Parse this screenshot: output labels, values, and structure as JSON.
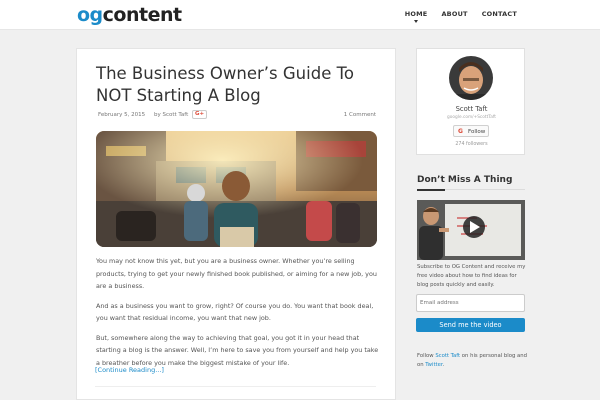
{
  "header": {
    "logo_og": "og",
    "logo_content": "content",
    "nav": [
      {
        "label": "HOME",
        "active": true
      },
      {
        "label": "ABOUT",
        "active": false
      },
      {
        "label": "CONTACT",
        "active": false
      }
    ]
  },
  "post": {
    "title": "The Business Owner’s Guide To NOT Starting A Blog",
    "date": "February 5, 2015",
    "author": "by Scott Taft",
    "gplus_label": "G+",
    "comments": "1 Comment",
    "paragraphs": [
      "You may not know this yet, but you are a business owner. Whether you’re selling products, trying to get your newly finished book published, or aiming for a new job, you are a business.",
      "And as a business you want to grow, right? Of course you do. You want that book deal, you want that residual income, you want that new job.",
      "But, somewhere along the way to achieving that goal, you got it in your head that starting a blog is the answer. Well, I’m here to save you from yourself and help you take a breather before you make the biggest mistake of your life."
    ],
    "read_more": "[Continue Reading...]"
  },
  "profile": {
    "name": "Scott Taft",
    "url": "google.com/+ScottTaft",
    "follow_g": "G",
    "follow_label": "Follow",
    "followers": "274 followers"
  },
  "widget": {
    "title": "Don’t Miss A Thing",
    "description": "Subscribe to OG Content and receive my free video about how to find ideas for blog posts quickly and easily.",
    "email_placeholder": "Email address",
    "send_label": "Send me the video"
  },
  "footer_note": {
    "prefix": "Follow ",
    "name_link": "Scott Taft",
    "middle": " on his personal blog and on ",
    "twitter_link": "Twitter",
    "suffix": "."
  },
  "colors": {
    "accent": "#1b8bc9",
    "gplus": "#dd4b39"
  }
}
